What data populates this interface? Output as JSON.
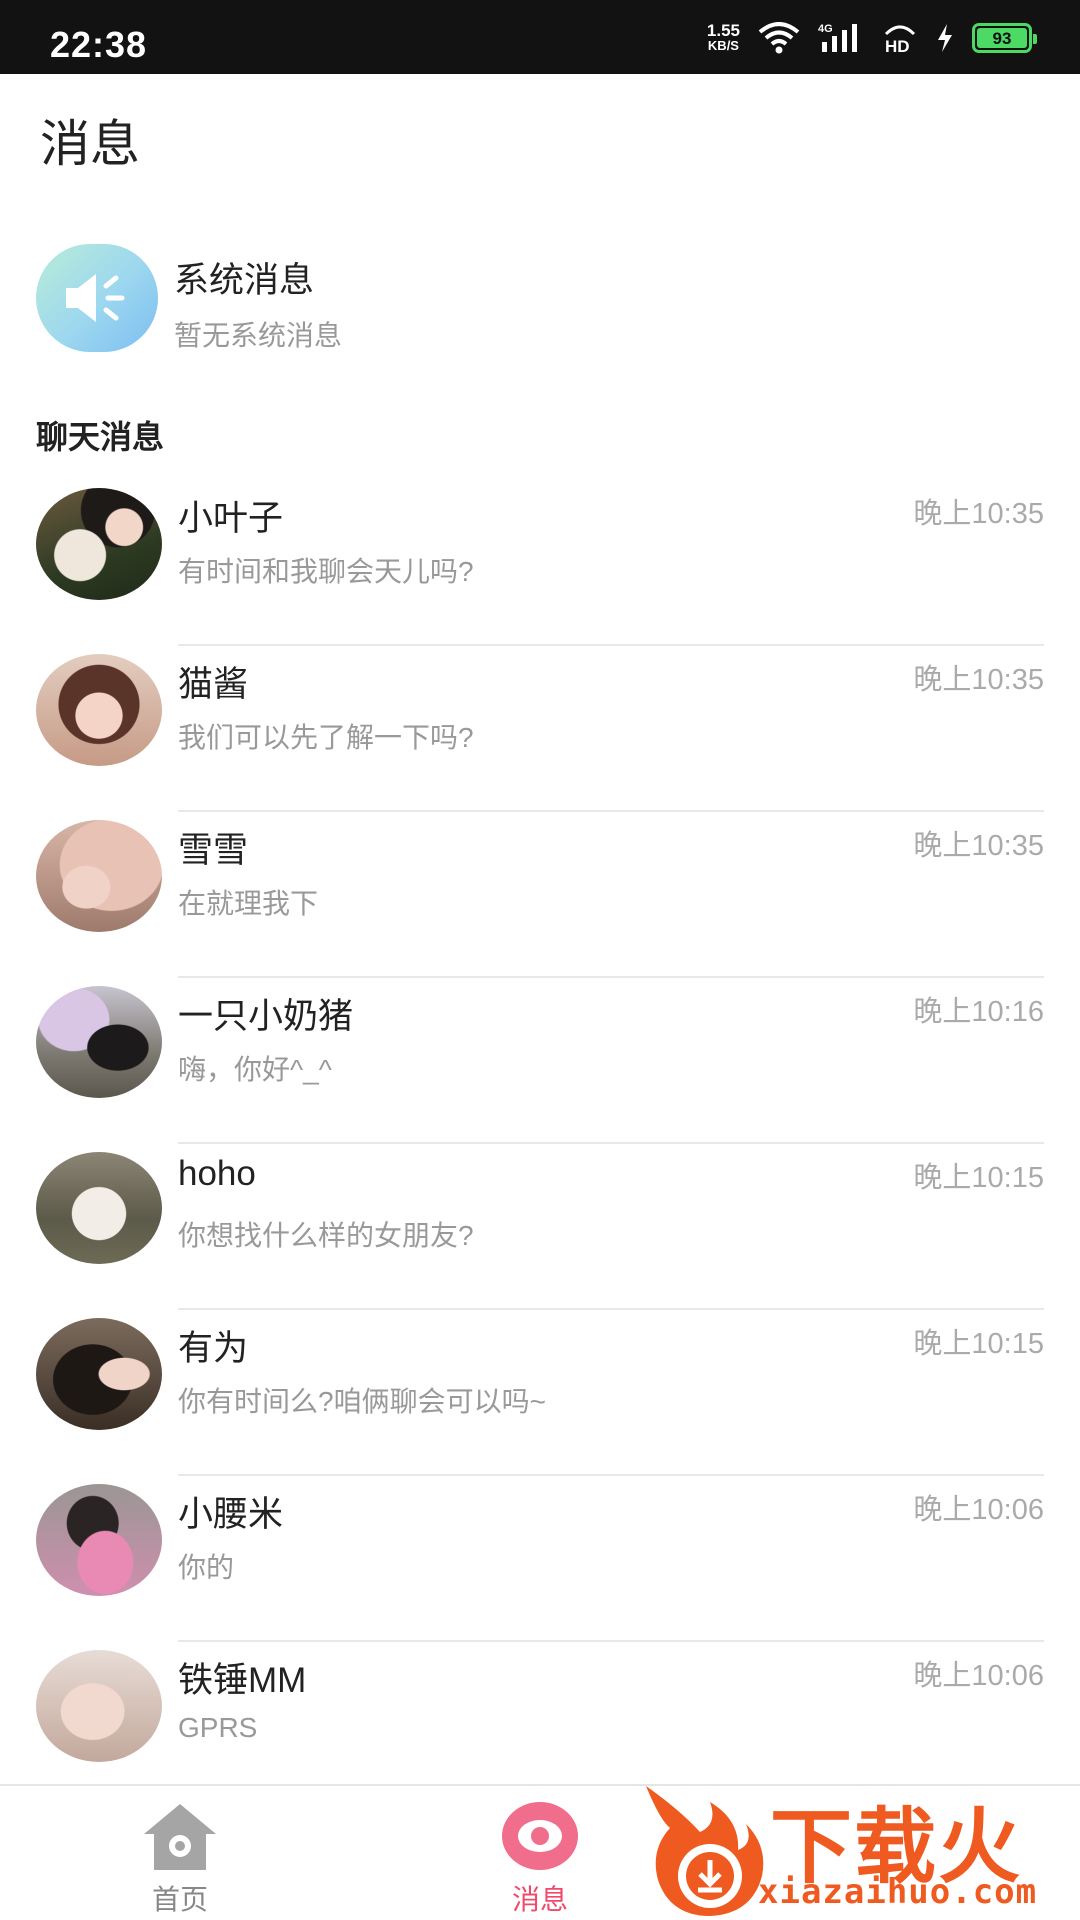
{
  "status_bar": {
    "time": "22:38",
    "net_speed_value": "1.55",
    "net_speed_unit": "KB/S",
    "network_label": "4G",
    "hd_label": "HD",
    "battery": "93"
  },
  "header": {
    "title": "消息"
  },
  "system": {
    "title": "系统消息",
    "subtitle": "暂无系统消息"
  },
  "section": {
    "chat_title": "聊天消息"
  },
  "chats": [
    {
      "name": "小叶子",
      "message": "有时间和我聊会天儿吗?",
      "time": "晚上10:35"
    },
    {
      "name": "猫酱",
      "message": "我们可以先了解一下吗?",
      "time": "晚上10:35"
    },
    {
      "name": "雪雪",
      "message": "在就理我下",
      "time": "晚上10:35"
    },
    {
      "name": "一只小奶猪",
      "message": "嗨，你好^_^",
      "time": "晚上10:16"
    },
    {
      "name": "hoho",
      "message": "你想找什么样的女朋友?",
      "time": "晚上10:15"
    },
    {
      "name": "有为",
      "message": "你有时间么?咱俩聊会可以吗~",
      "time": "晚上10:15"
    },
    {
      "name": "小腰米",
      "message": "你的",
      "time": "晚上10:06"
    },
    {
      "name": "铁锤MM",
      "message": "GPRS",
      "time": "晚上10:06"
    }
  ],
  "nav": {
    "home_label": "首页",
    "messages_label": "消息"
  },
  "watermark": {
    "text": "下载火",
    "url": "xiazaihuo.com"
  },
  "colors": {
    "accent": "#f04a6a",
    "watermark": "#ee5a1f",
    "battery": "#4cd964"
  }
}
